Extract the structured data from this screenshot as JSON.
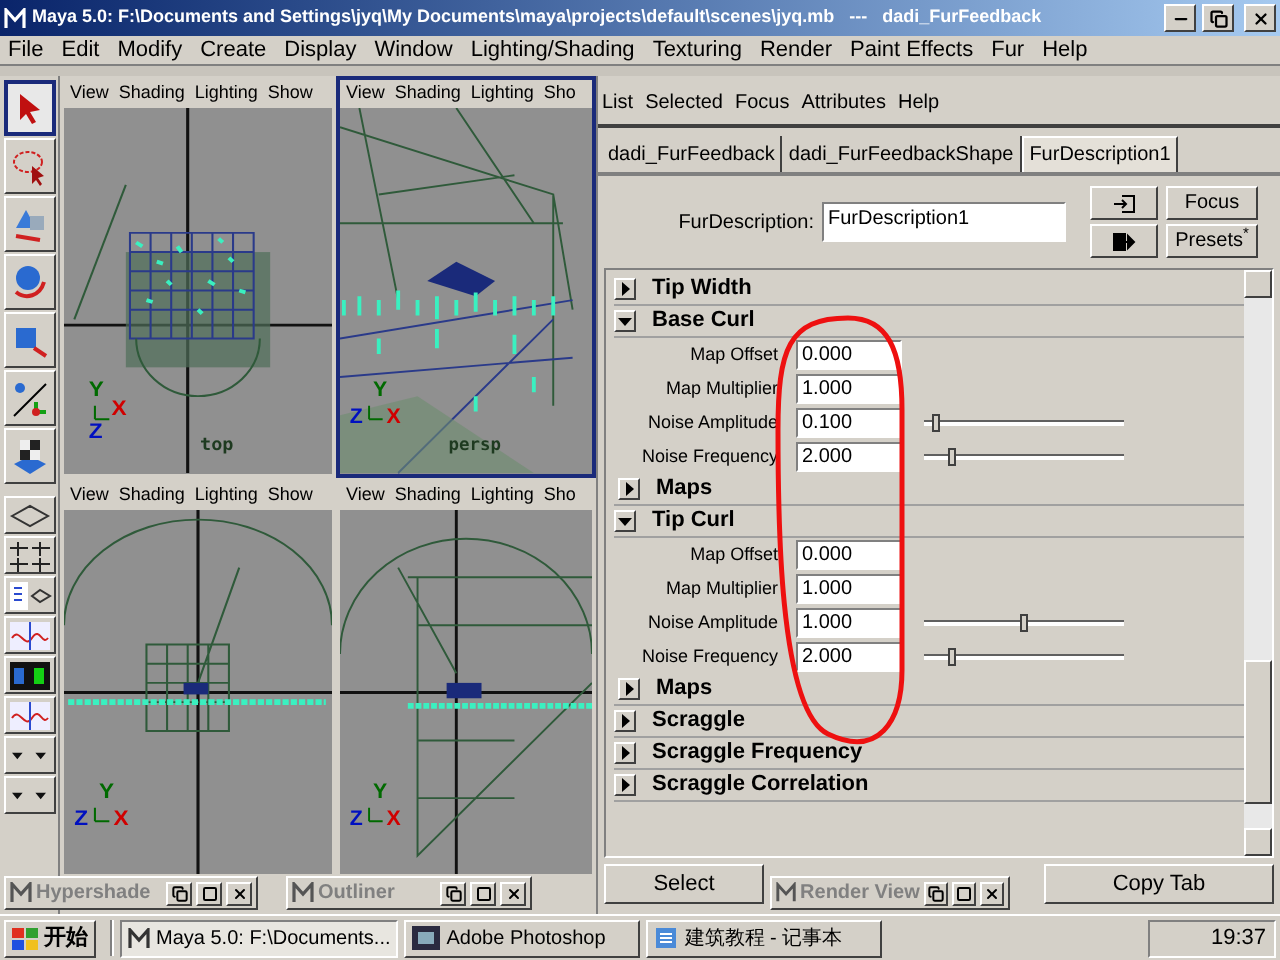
{
  "window": {
    "title": "Maya 5.0: F:\\Documents and Settings\\jyq\\My Documents\\maya\\projects\\default\\scenes\\jyq.mb   ---   dadi_FurFeedback"
  },
  "menu": [
    "File",
    "Edit",
    "Modify",
    "Create",
    "Display",
    "Window",
    "Lighting/Shading",
    "Texturing",
    "Render",
    "Paint Effects",
    "Fur",
    "Help"
  ],
  "toolbox": {
    "tools": [
      {
        "kind": "select",
        "selected": true
      },
      {
        "kind": "lasso",
        "selected": false
      },
      {
        "kind": "move",
        "selected": false
      },
      {
        "kind": "rotate",
        "selected": false
      },
      {
        "kind": "scale",
        "selected": false
      },
      {
        "kind": "manip",
        "selected": false
      },
      {
        "kind": "last",
        "selected": false
      }
    ],
    "layouts": [
      {
        "kind": "single"
      },
      {
        "kind": "quad"
      },
      {
        "kind": "outliner"
      },
      {
        "kind": "graph"
      },
      {
        "kind": "hyper"
      },
      {
        "kind": "graph"
      },
      {
        "kind": "menu"
      },
      {
        "kind": "menu"
      }
    ]
  },
  "viewports": [
    {
      "kind": "top",
      "menu": [
        "View",
        "Shading",
        "Lighting",
        "Show"
      ],
      "label": "top",
      "selected": false,
      "axes": [
        {
          "label": "Y",
          "color": "#006a00"
        },
        {
          "label": "X",
          "color": "#d00000"
        },
        {
          "label": "Z",
          "color": "#0010c0"
        }
      ]
    },
    {
      "kind": "persp",
      "menu": [
        "View",
        "Shading",
        "Lighting",
        "Sho"
      ],
      "label": "persp",
      "selected": true,
      "axes": [
        {
          "label": "Y",
          "color": "#006a00"
        },
        {
          "label": "Z",
          "color": "#0010c0"
        },
        {
          "label": "X",
          "color": "#d00000"
        }
      ]
    },
    {
      "kind": "front",
      "menu": [
        "View",
        "Shading",
        "Lighting",
        "Show"
      ],
      "selected": false,
      "axes": [
        {
          "label": "Y",
          "color": "#006a00"
        },
        {
          "label": "Z",
          "color": "#0010c0"
        },
        {
          "label": "X",
          "color": "#d00000"
        }
      ]
    },
    {
      "kind": "side",
      "menu": [
        "View",
        "Shading",
        "Lighting",
        "Sho"
      ],
      "selected": false,
      "axes": [
        {
          "label": "Y",
          "color": "#006a00"
        },
        {
          "label": "Z",
          "color": "#0010c0"
        },
        {
          "label": "X",
          "color": "#d00000"
        }
      ]
    }
  ],
  "attribute_editor": {
    "menu": [
      "List",
      "Selected",
      "Focus",
      "Attributes",
      "Help"
    ],
    "tabs": [
      {
        "label": "dadi_FurFeedback",
        "selected": false
      },
      {
        "label": "dadi_FurFeedbackShape",
        "selected": false
      },
      {
        "label": "FurDescription1",
        "selected": true
      }
    ],
    "name_field": {
      "label": "FurDescription:",
      "value": "FurDescription1"
    },
    "buttons": [
      "Focus",
      "Presets$^{*}$"
    ],
    "rows": [
      {
        "kind": "section",
        "label": "Tip Width",
        "expanded": false
      },
      {
        "kind": "section",
        "label": "Base Curl",
        "expanded": true
      },
      {
        "kind": "field",
        "label": "Map Offset",
        "value": "0.000"
      },
      {
        "kind": "field",
        "label": "Map Multiplier",
        "value": "1.000"
      },
      {
        "kind": "slider",
        "label": "Noise Amplitude",
        "value": "0.100",
        "level": 0.04
      },
      {
        "kind": "slider",
        "label": "Noise Frequency",
        "value": "2.000",
        "level": 0.12
      },
      {
        "kind": "subsection",
        "label": "Maps",
        "expanded": false
      },
      {
        "kind": "section",
        "label": "Tip Curl",
        "expanded": true
      },
      {
        "kind": "field",
        "label": "Map Offset",
        "value": "0.000"
      },
      {
        "kind": "field",
        "label": "Map Multiplier",
        "value": "1.000"
      },
      {
        "kind": "slider",
        "label": "Noise Amplitude",
        "value": "1.000",
        "level": 0.5
      },
      {
        "kind": "slider",
        "label": "Noise Frequency",
        "value": "2.000",
        "level": 0.12
      },
      {
        "kind": "subsection",
        "label": "Maps",
        "expanded": false
      },
      {
        "kind": "section",
        "label": "Scraggle",
        "expanded": false
      },
      {
        "kind": "section",
        "label": "Scraggle Frequency",
        "expanded": false
      },
      {
        "kind": "section",
        "label": "Scraggle Correlation",
        "expanded": false
      }
    ],
    "bottom_buttons": [
      "Select",
      "Copy Tab"
    ]
  },
  "floating_windows": [
    {
      "title": "Hypershade"
    },
    {
      "title": "Outliner"
    },
    {
      "title": "Render View"
    }
  ],
  "taskbar": {
    "start": "开始",
    "tasks": [
      {
        "kind": "maya",
        "label": "Maya 5.0: F:\\Documents...",
        "selected": true
      },
      {
        "kind": "photoshop",
        "label": "Adobe Photoshop",
        "selected": false
      },
      {
        "kind": "notepad",
        "label": "建筑教程 - 记事本",
        "selected": false
      }
    ],
    "clock": "19:37"
  }
}
